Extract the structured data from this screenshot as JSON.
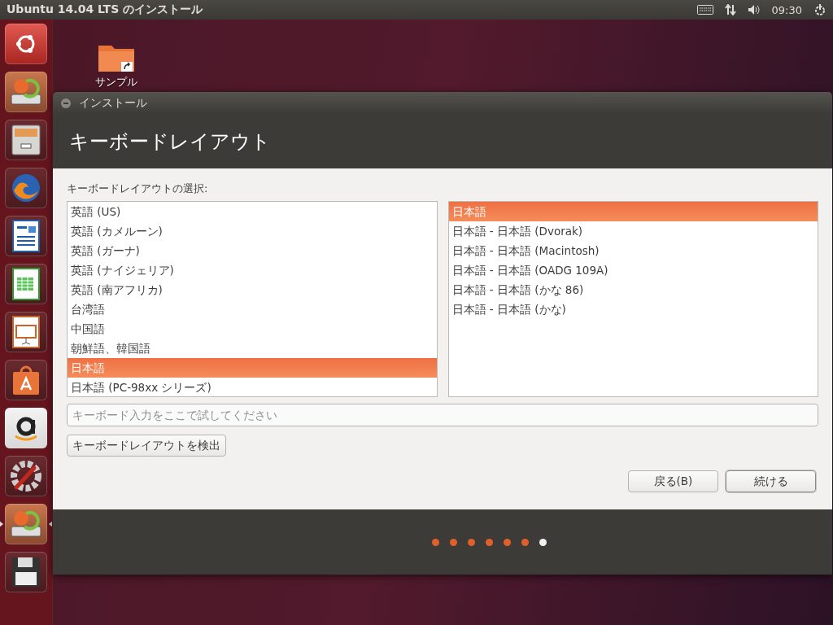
{
  "top_panel": {
    "title": "Ubuntu 14.04 LTS のインストール",
    "clock": "09:30"
  },
  "launcher": [
    {
      "kind": "dash",
      "active": false
    },
    {
      "kind": "installer",
      "active": false
    },
    {
      "kind": "files",
      "active": false
    },
    {
      "kind": "browser",
      "active": false
    },
    {
      "kind": "writer",
      "active": false
    },
    {
      "kind": "calc",
      "active": false
    },
    {
      "kind": "impress",
      "active": false
    },
    {
      "kind": "store",
      "active": false
    },
    {
      "kind": "amazon",
      "active": false
    },
    {
      "kind": "settings",
      "active": false
    },
    {
      "kind": "installer",
      "active": true
    },
    {
      "kind": "floppy",
      "active": false
    }
  ],
  "desktop_icons": [
    {
      "label": "サンプル"
    }
  ],
  "window": {
    "title": "インストール",
    "heading": "キーボードレイアウト",
    "prompt": "キーボードレイアウトの選択:",
    "layouts": [
      {
        "label": "英語 (US)",
        "selected": false
      },
      {
        "label": "英語 (カメルーン)",
        "selected": false
      },
      {
        "label": "英語 (ガーナ)",
        "selected": false
      },
      {
        "label": "英語 (ナイジェリア)",
        "selected": false
      },
      {
        "label": "英語 (南アフリカ)",
        "selected": false
      },
      {
        "label": "台湾語",
        "selected": false
      },
      {
        "label": "中国語",
        "selected": false
      },
      {
        "label": "朝鮮語、韓国語",
        "selected": false
      },
      {
        "label": "日本語",
        "selected": true
      },
      {
        "label": "日本語 (PC-98xx シリーズ)",
        "selected": false
      }
    ],
    "variants": [
      {
        "label": "日本語",
        "selected": true
      },
      {
        "label": "日本語 - 日本語 (Dvorak)",
        "selected": false
      },
      {
        "label": "日本語 - 日本語 (Macintosh)",
        "selected": false
      },
      {
        "label": "日本語 - 日本語 (OADG 109A)",
        "selected": false
      },
      {
        "label": "日本語 - 日本語 (かな 86)",
        "selected": false
      },
      {
        "label": "日本語 - 日本語 (かな)",
        "selected": false
      }
    ],
    "test_field": {
      "placeholder": "キーボード入力をここで試してください"
    },
    "detect_button": "キーボードレイアウトを検出",
    "buttons": [
      {
        "label": "戻る(B)",
        "default": false
      },
      {
        "label": "続ける",
        "default": true
      }
    ],
    "progress": [
      {
        "done": true
      },
      {
        "done": true
      },
      {
        "done": true
      },
      {
        "done": true
      },
      {
        "done": true
      },
      {
        "done": true
      },
      {
        "done": false
      }
    ]
  }
}
